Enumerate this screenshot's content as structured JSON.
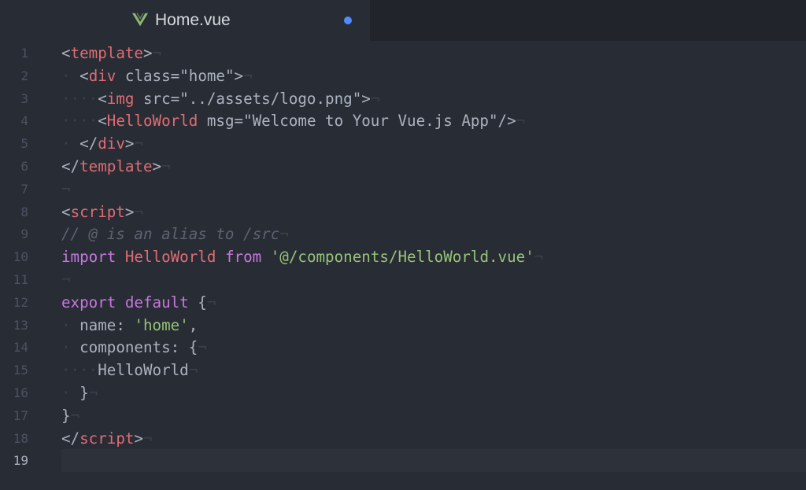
{
  "tab": {
    "icon": "vue-logo-icon",
    "title": "Home.vue",
    "modified": true
  },
  "colors": {
    "background": "#282c34",
    "tag": "#e06c75",
    "string": "#98c379",
    "keyword": "#c678dd",
    "comment": "#5c6370",
    "text": "#abb2bf",
    "modified_dot": "#528bff"
  },
  "lines": [
    {
      "n": "1",
      "tokens": [
        [
          "t-punct",
          "<"
        ],
        [
          "t-tag",
          "template"
        ],
        [
          "t-punct",
          ">"
        ],
        [
          "t-ws",
          "¬"
        ]
      ]
    },
    {
      "n": "2",
      "tokens": [
        [
          "t-ws",
          "·"
        ],
        [
          "t-ws",
          " "
        ],
        [
          "t-punct",
          "<"
        ],
        [
          "t-tag",
          "div"
        ],
        [
          "t-attrplain",
          " class="
        ],
        [
          "t-attrplain",
          "\"home\""
        ],
        [
          "t-punct",
          ">"
        ],
        [
          "t-ws",
          "¬"
        ]
      ]
    },
    {
      "n": "3",
      "tokens": [
        [
          "t-ws",
          "·"
        ],
        [
          "t-ws",
          "···"
        ],
        [
          "t-punct",
          "<"
        ],
        [
          "t-tag",
          "img"
        ],
        [
          "t-attrplain",
          " src="
        ],
        [
          "t-attrplain",
          "\"../assets/logo.png\""
        ],
        [
          "t-punct",
          ">"
        ],
        [
          "t-ws",
          "¬"
        ]
      ]
    },
    {
      "n": "4",
      "tokens": [
        [
          "t-ws",
          "····"
        ],
        [
          "t-punct",
          "<"
        ],
        [
          "t-tag",
          "HelloWorld"
        ],
        [
          "t-attrplain",
          " msg="
        ],
        [
          "t-attrplain",
          "\"Welcome to Your Vue.js App\""
        ],
        [
          "t-punct",
          "/>"
        ],
        [
          "t-ws",
          "¬"
        ]
      ]
    },
    {
      "n": "5",
      "tokens": [
        [
          "t-ws",
          "·"
        ],
        [
          "t-ws",
          " "
        ],
        [
          "t-punct",
          "</"
        ],
        [
          "t-tag",
          "div"
        ],
        [
          "t-punct",
          ">"
        ],
        [
          "t-ws",
          "¬"
        ]
      ]
    },
    {
      "n": "6",
      "tokens": [
        [
          "t-punct",
          "</"
        ],
        [
          "t-tag",
          "template"
        ],
        [
          "t-punct",
          ">"
        ],
        [
          "t-ws",
          "¬"
        ]
      ]
    },
    {
      "n": "7",
      "tokens": [
        [
          "t-ws",
          "¬"
        ]
      ]
    },
    {
      "n": "8",
      "tokens": [
        [
          "t-punct",
          "<"
        ],
        [
          "t-tag",
          "script"
        ],
        [
          "t-punct",
          ">"
        ],
        [
          "t-ws",
          "¬"
        ]
      ]
    },
    {
      "n": "9",
      "tokens": [
        [
          "t-comment",
          "// @ is an alias to /src"
        ],
        [
          "t-ws",
          "¬"
        ]
      ]
    },
    {
      "n": "10",
      "tokens": [
        [
          "t-kw",
          "import"
        ],
        [
          "t-punct",
          " "
        ],
        [
          "t-prop",
          "HelloWorld"
        ],
        [
          "t-punct",
          " "
        ],
        [
          "t-kw",
          "from"
        ],
        [
          "t-punct",
          " "
        ],
        [
          "t-str",
          "'@/components/HelloWorld.vue'"
        ],
        [
          "t-ws",
          "¬"
        ]
      ]
    },
    {
      "n": "11",
      "tokens": [
        [
          "t-ws",
          "¬"
        ]
      ]
    },
    {
      "n": "12",
      "tokens": [
        [
          "t-kw",
          "export"
        ],
        [
          "t-punct",
          " "
        ],
        [
          "t-kw",
          "default"
        ],
        [
          "t-punct",
          " {"
        ],
        [
          "t-ws",
          "¬"
        ]
      ]
    },
    {
      "n": "13",
      "tokens": [
        [
          "t-ws",
          "·"
        ],
        [
          "t-ws",
          " "
        ],
        [
          "t-attrplain",
          "name"
        ],
        [
          "t-punct",
          ": "
        ],
        [
          "t-str",
          "'home'"
        ],
        [
          "t-punct",
          ","
        ]
      ]
    },
    {
      "n": "14",
      "tokens": [
        [
          "t-ws",
          "·"
        ],
        [
          "t-ws",
          " "
        ],
        [
          "t-attrplain",
          "components"
        ],
        [
          "t-punct",
          ": {"
        ],
        [
          "t-ws",
          "¬"
        ]
      ]
    },
    {
      "n": "15",
      "tokens": [
        [
          "t-ws",
          "····"
        ],
        [
          "t-attrplain",
          "HelloWorld"
        ],
        [
          "t-ws",
          "¬"
        ]
      ]
    },
    {
      "n": "16",
      "tokens": [
        [
          "t-ws",
          "·"
        ],
        [
          "t-ws",
          " "
        ],
        [
          "t-punct",
          "}"
        ],
        [
          "t-ws",
          "¬"
        ]
      ]
    },
    {
      "n": "17",
      "tokens": [
        [
          "t-punct",
          "}"
        ],
        [
          "t-ws",
          "¬"
        ]
      ]
    },
    {
      "n": "18",
      "tokens": [
        [
          "t-punct",
          "</"
        ],
        [
          "t-tag",
          "script"
        ],
        [
          "t-punct",
          ">"
        ],
        [
          "t-ws",
          "¬"
        ]
      ]
    },
    {
      "n": "19",
      "tokens": [],
      "cursor": true
    }
  ]
}
